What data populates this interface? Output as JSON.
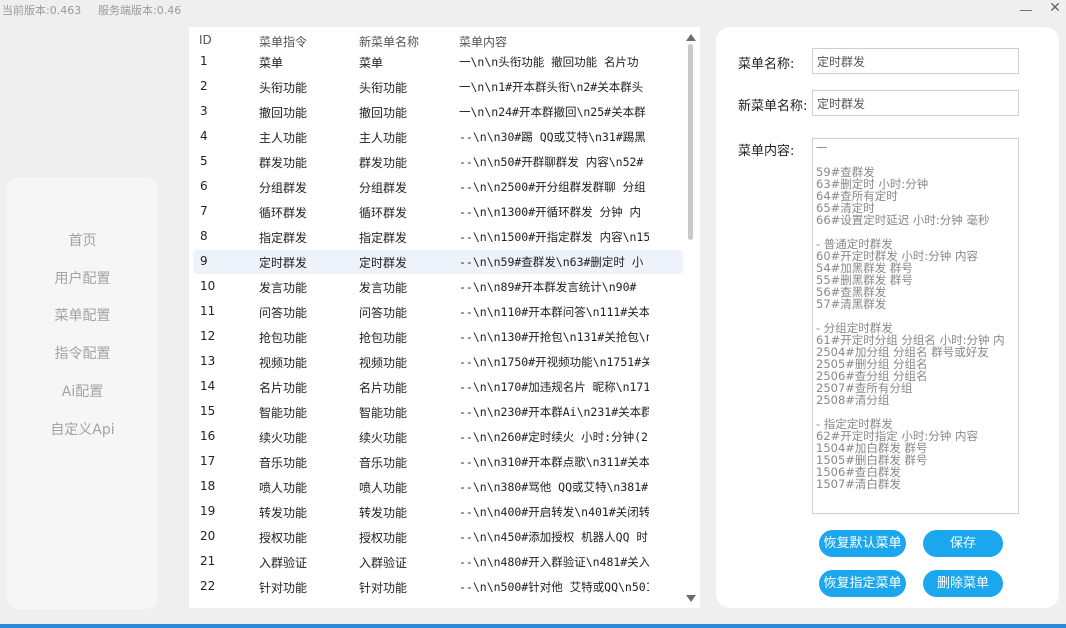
{
  "topbar": {
    "client_version": "当前版本:0.463",
    "server_version": "服务端版本:0.46",
    "minimize_glyph": "—",
    "close_glyph": "✕"
  },
  "nav": {
    "items": [
      {
        "label": "首页"
      },
      {
        "label": "用户配置"
      },
      {
        "label": "菜单配置"
      },
      {
        "label": "指令配置"
      },
      {
        "label": "Ai配置"
      },
      {
        "label": "自定义Api"
      }
    ]
  },
  "table": {
    "columns": [
      "ID",
      "菜单指令",
      "新菜单名称",
      "菜单内容"
    ],
    "selected_index": 8,
    "rows": [
      {
        "id": "1",
        "cmd": "菜单",
        "new": "菜单",
        "content": "一\\n\\n头衔功能 撤回功能 名片功"
      },
      {
        "id": "2",
        "cmd": "头衔功能",
        "new": "头衔功能",
        "content": "一\\n\\n1#开本群头衔\\n2#关本群头"
      },
      {
        "id": "3",
        "cmd": "撤回功能",
        "new": "撤回功能",
        "content": "一\\n\\n24#开本群撤回\\n25#关本群"
      },
      {
        "id": "4",
        "cmd": "主人功能",
        "new": "主人功能",
        "content": "--\\n\\n30#踢 QQ或艾特\\n31#踢黑"
      },
      {
        "id": "5",
        "cmd": "群发功能",
        "new": "群发功能",
        "content": "--\\n\\n50#开群聊群发 内容\\n52#"
      },
      {
        "id": "6",
        "cmd": "分组群发",
        "new": "分组群发",
        "content": "--\\n\\n2500#开分组群发群聊 分组"
      },
      {
        "id": "7",
        "cmd": "循环群发",
        "new": "循环群发",
        "content": "--\\n\\n1300#开循环群发 分钟 内"
      },
      {
        "id": "8",
        "cmd": "指定群发",
        "new": "指定群发",
        "content": "--\\n\\n1500#开指定群发 内容\\n15"
      },
      {
        "id": "9",
        "cmd": "定时群发",
        "new": "定时群发",
        "content": "--\\n\\n59#查群发\\n63#删定时 小"
      },
      {
        "id": "10",
        "cmd": "发言功能",
        "new": "发言功能",
        "content": "--\\n\\n89#开本群发言统计\\n90#"
      },
      {
        "id": "11",
        "cmd": "问答功能",
        "new": "问答功能",
        "content": "--\\n\\n110#开本群问答\\n111#关本"
      },
      {
        "id": "12",
        "cmd": "抢包功能",
        "new": "抢包功能",
        "content": "--\\n\\n130#开抢包\\n131#关抢包\\n"
      },
      {
        "id": "13",
        "cmd": "视频功能",
        "new": "视频功能",
        "content": "--\\n\\n1750#开视频功能\\n1751#关"
      },
      {
        "id": "14",
        "cmd": "名片功能",
        "new": "名片功能",
        "content": "--\\n\\n170#加违规名片 昵称\\n171"
      },
      {
        "id": "15",
        "cmd": "智能功能",
        "new": "智能功能",
        "content": "--\\n\\n230#开本群Ai\\n231#关本群"
      },
      {
        "id": "16",
        "cmd": "续火功能",
        "new": "续火功能",
        "content": "--\\n\\n260#定时续火 小时:分钟(2"
      },
      {
        "id": "17",
        "cmd": "音乐功能",
        "new": "音乐功能",
        "content": "--\\n\\n310#开本群点歌\\n311#关本"
      },
      {
        "id": "18",
        "cmd": "喷人功能",
        "new": "喷人功能",
        "content": "--\\n\\n380#骂他 QQ或艾特\\n381#"
      },
      {
        "id": "19",
        "cmd": "转发功能",
        "new": "转发功能",
        "content": "--\\n\\n400#开启转发\\n401#关闭转"
      },
      {
        "id": "20",
        "cmd": "授权功能",
        "new": "授权功能",
        "content": "--\\n\\n450#添加授权 机器人QQ 时"
      },
      {
        "id": "21",
        "cmd": "入群验证",
        "new": "入群验证",
        "content": "--\\n\\n480#开入群验证\\n481#关入"
      },
      {
        "id": "22",
        "cmd": "针对功能",
        "new": "针对功能",
        "content": "--\\n\\n500#针对他 艾特或QQ\\n501"
      }
    ]
  },
  "editor": {
    "menu_name_label": "菜单名称:",
    "menu_name_value": "定时群发",
    "new_name_label": "新菜单名称:",
    "new_name_value": "定时群发",
    "content_label": "菜单内容:",
    "content_value": "一\n\n59#查群发\n63#删定时 小时:分钟\n64#查所有定时\n65#清定时\n66#设置定时延迟 小时:分钟 毫秒\n\n- 普通定时群发\n60#开定时群发 小时:分钟 内容\n54#加黑群发 群号\n55#删黑群发 群号\n56#查黑群发\n57#清黑群发\n\n- 分组定时群发\n61#开定时分组 分组名 小时:分钟 内\n2504#加分组 分组名 群号或好友\n2505#删分组 分组名\n2506#查分组 分组名\n2507#查所有分组\n2508#清分组\n\n- 指定定时群发\n62#开定时指定 小时:分钟 内容\n1504#加白群发 群号\n1505#删白群发 群号\n1506#查白群发\n1507#清白群发",
    "buttons": {
      "restore_default": "恢复默认菜单",
      "save": "保存",
      "restore_specified": "恢复指定菜单",
      "delete": "删除菜单"
    }
  },
  "colors": {
    "accent": "#1aa7ee",
    "selected_row": "#eef2fa"
  }
}
